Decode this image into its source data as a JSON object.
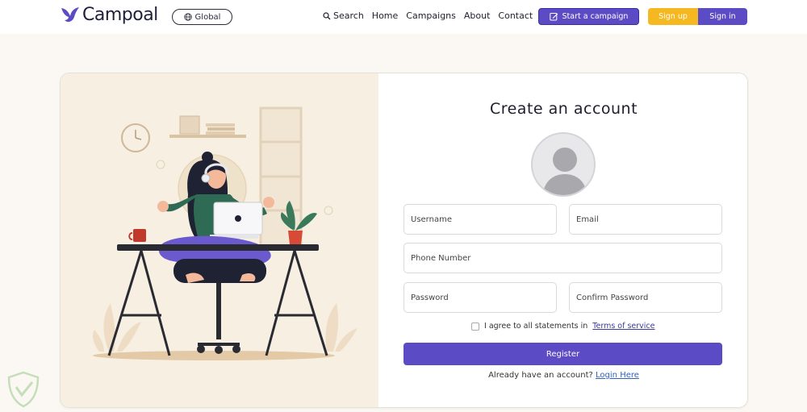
{
  "header": {
    "brand": "Campoal",
    "global_label": "Global",
    "nav": [
      {
        "label": "Search",
        "icon": "search-icon"
      },
      {
        "label": "Home"
      },
      {
        "label": "Campaigns"
      },
      {
        "label": "About"
      },
      {
        "label": "Contact"
      }
    ],
    "start_campaign": "Start a campaign",
    "sign_up": "Sign up",
    "sign_in": "Sign in"
  },
  "form": {
    "title": "Create an account",
    "fields": {
      "username": "Username",
      "email": "Email",
      "phone": "Phone Number",
      "password": "Password",
      "confirm_password": "Confirm Password"
    },
    "agree_text": "I agree to all statements in",
    "terms_link": "Terms of service",
    "register": "Register",
    "already": "Already have an account?",
    "login_link": "Login Here"
  },
  "colors": {
    "accent": "#5b4bc4",
    "signup": "#f5b820",
    "illustration_bg": "#f6efe2"
  }
}
